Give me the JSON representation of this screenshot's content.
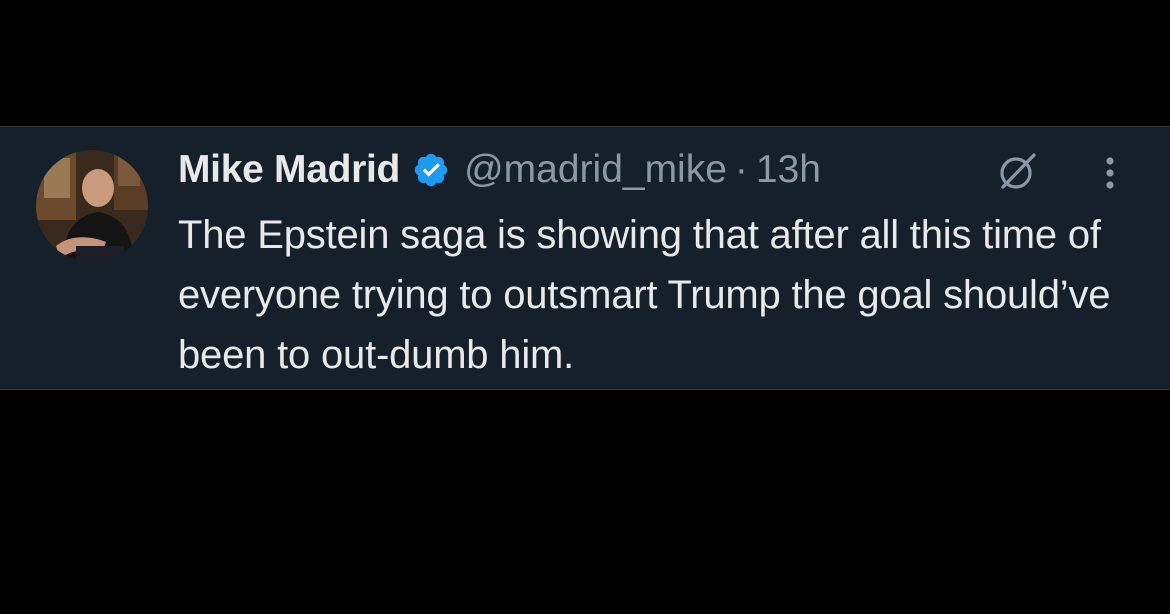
{
  "tweet": {
    "author_name": "Mike Madrid",
    "verified": true,
    "handle": "@madrid_mike",
    "separator": "·",
    "timestamp": "13h",
    "text": "The Epstein saga is showing that after all this time of everyone trying to outsmart Trump the goal should’ve been to out-dumb him.",
    "icons": {
      "avatar": "profile-photo",
      "verified": "verified-badge-icon",
      "grok": "grok-icon",
      "more": "more-options-icon"
    }
  },
  "colors": {
    "background": "#000000",
    "card": "#15202b",
    "text_primary": "#e7e9ea",
    "text_secondary": "#8b98a5",
    "verified_blue": "#1d9bf0"
  }
}
